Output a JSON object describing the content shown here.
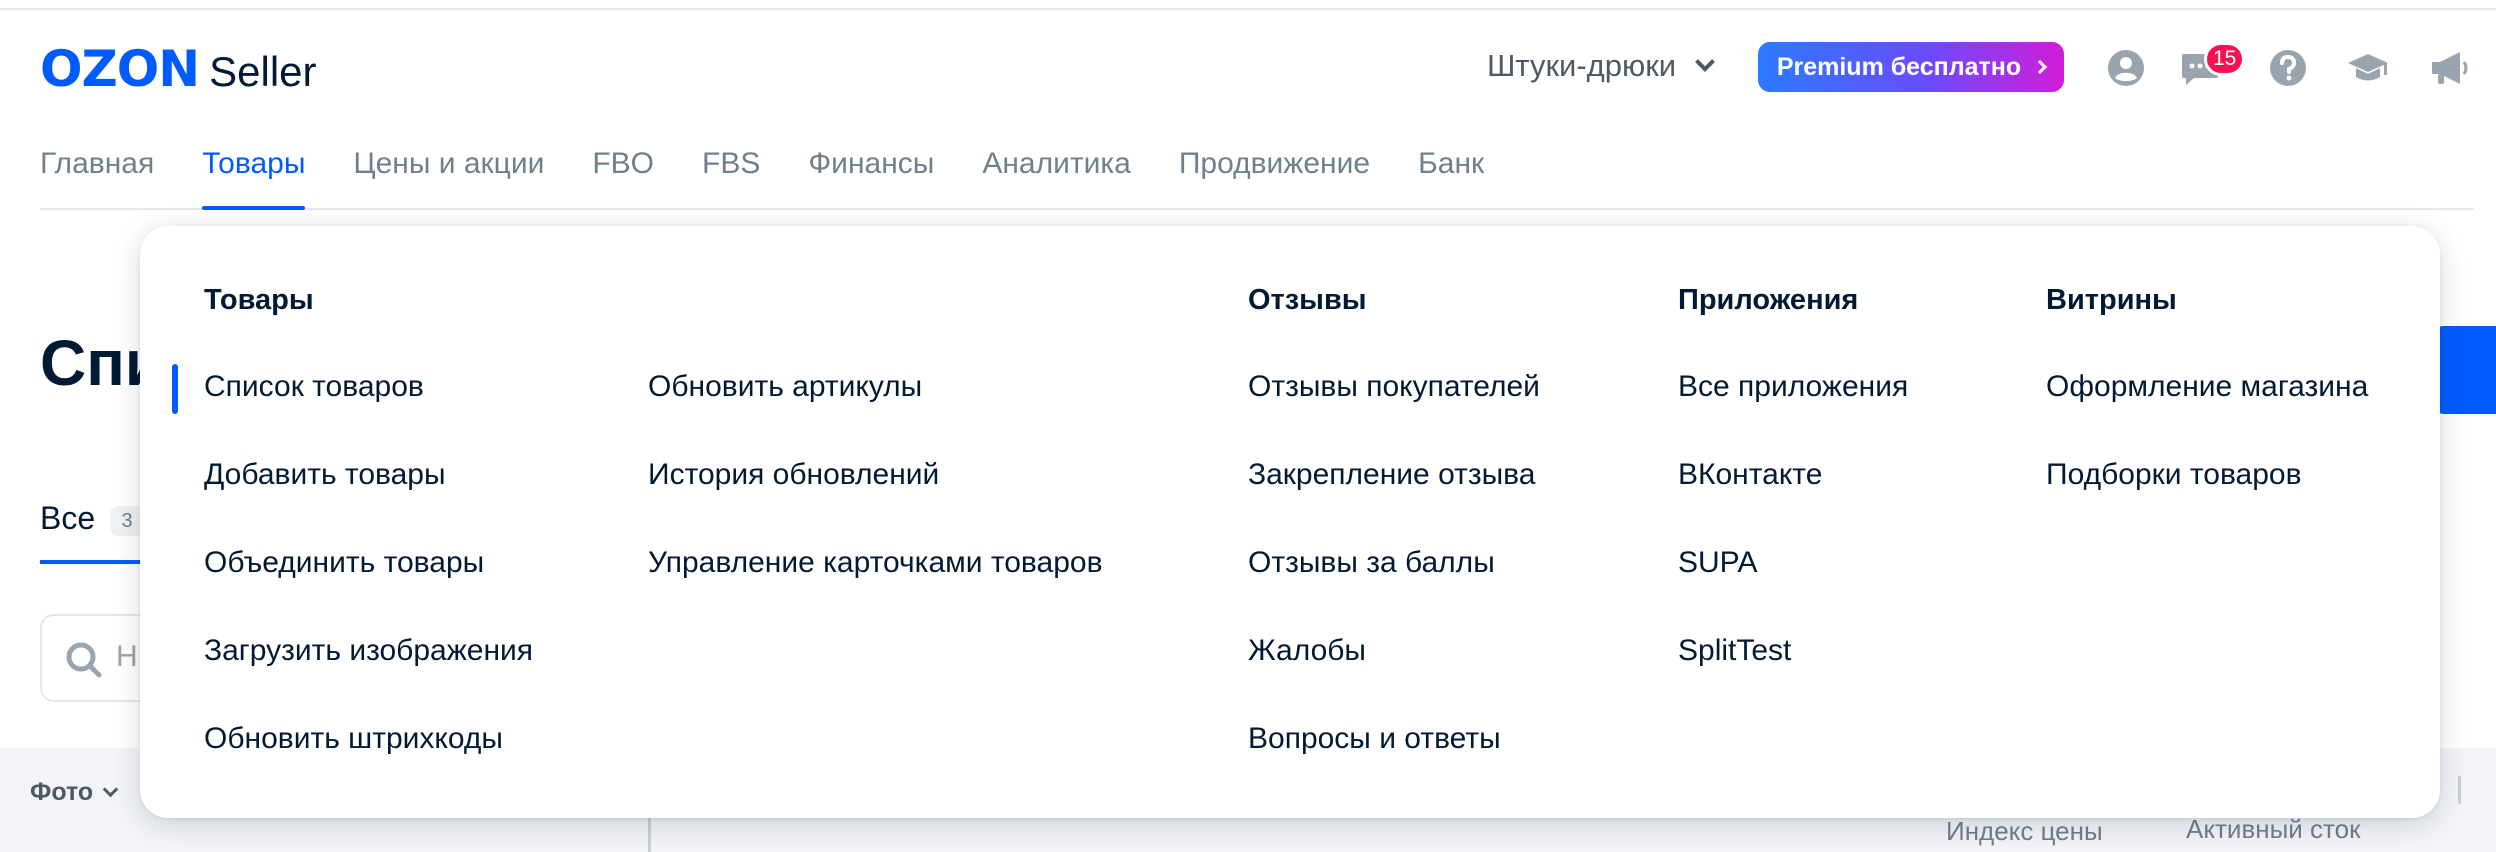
{
  "header": {
    "logo_brand": "OZON",
    "logo_product": "Seller",
    "store_name": "Штуки-дрюки",
    "premium_label": "Premium бесплатно",
    "notifications_count": "15"
  },
  "nav": {
    "items": [
      "Главная",
      "Товары",
      "Цены и акции",
      "FBO",
      "FBS",
      "Финансы",
      "Аналитика",
      "Продвижение",
      "Банк"
    ],
    "active": "Товары"
  },
  "background": {
    "title": "Спи",
    "tab_all": "Все",
    "tab_all_count": "3",
    "search_placeholder": "Н",
    "col_photo": "Фото",
    "col_price_index": "Индекс цены",
    "col_active_stock": "Активный сток"
  },
  "menu": {
    "products": {
      "heading": "Товары",
      "col1": [
        "Список товаров",
        "Добавить товары",
        "Объединить товары",
        "Загрузить изображения",
        "Обновить штрихкоды"
      ],
      "col2": [
        "Обновить артикулы",
        "История обновлений",
        "Управление карточками товаров"
      ]
    },
    "reviews": {
      "heading": "Отзывы",
      "items": [
        "Отзывы покупателей",
        "Закрепление отзыва",
        "Отзывы за баллы",
        "Жалобы",
        "Вопросы и ответы"
      ]
    },
    "apps": {
      "heading": "Приложения",
      "items": [
        "Все приложения",
        "ВКонтакте",
        "SUPA",
        "SplitTest"
      ]
    },
    "showcases": {
      "heading": "Витрины",
      "items": [
        "Оформление магазина",
        "Подборки товаров"
      ]
    }
  },
  "colors": {
    "accent": "#005bff",
    "text": "#001a34",
    "muted": "#707f8d",
    "badge": "#f91155",
    "premium_gradient": [
      "#2a7bff",
      "#6a4cff",
      "#d21cd8"
    ]
  },
  "icons": [
    "chevron-down-icon",
    "chevron-right-icon",
    "profile-icon",
    "chat-icon",
    "help-icon",
    "education-icon",
    "megaphone-icon",
    "search-icon"
  ]
}
